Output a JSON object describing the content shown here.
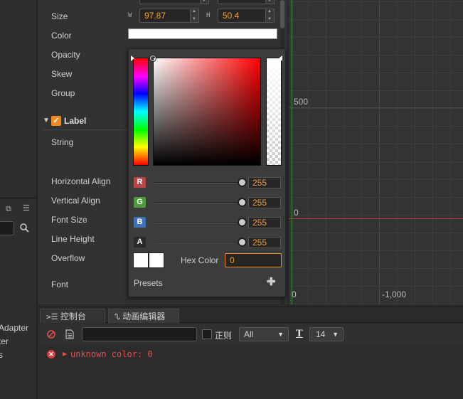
{
  "left_panel": {
    "items": [
      "Adapter",
      "ter",
      "s"
    ]
  },
  "inspector": {
    "size_label": "Size",
    "size_w_tag": "W",
    "size_w": "97.87",
    "size_h_tag": "H",
    "size_h": "50.4",
    "color_label": "Color",
    "color_value": "#ffffff",
    "opacity_label": "Opacity",
    "skew_label": "Skew",
    "group_label": "Group",
    "label_component": "Label",
    "string_label": "String",
    "halign_label": "Horizontal Align",
    "valign_label": "Vertical Align",
    "fontsize_label": "Font Size",
    "lineheight_label": "Line Height",
    "overflow_label": "Overflow",
    "font_label": "Font"
  },
  "scene": {
    "tick_500": "500",
    "tick_0_y": "0",
    "tick_0_x": "0",
    "tick_neg1000": "-1,000"
  },
  "picker": {
    "channels": [
      {
        "tag": "R",
        "value": "255",
        "color": "#b84848"
      },
      {
        "tag": "G",
        "value": "255",
        "color": "#4e9a3c"
      },
      {
        "tag": "B",
        "value": "255",
        "color": "#3f73b8"
      },
      {
        "tag": "A",
        "value": "255",
        "color": "#2a2a2a"
      }
    ],
    "hex_label": "Hex Color",
    "hex_value": "0",
    "presets_label": "Presets",
    "presets_add": "✚"
  },
  "console": {
    "tab_console": "控制台",
    "tab_anim": "动画编辑器",
    "regex_label": "正则",
    "level_value": "All",
    "font_size_value": "14",
    "log": "unknown color: 0"
  }
}
